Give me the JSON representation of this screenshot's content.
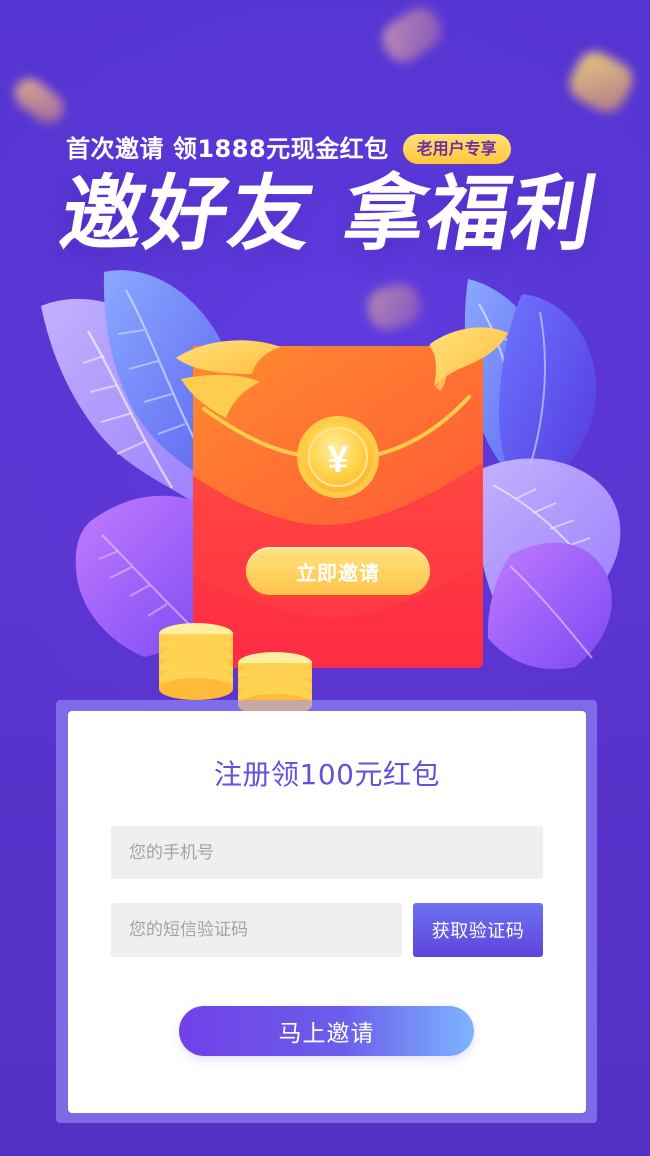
{
  "hero": {
    "subtitle": "首次邀请 领1888元现金红包",
    "badge": "老用户专享",
    "title": "邀好友 拿福利"
  },
  "envelope": {
    "currency_symbol": "¥",
    "button_label": "立即邀请"
  },
  "form": {
    "title": "注册领100元红包",
    "phone_placeholder": "您的手机号",
    "sms_placeholder": "您的短信验证码",
    "get_code_label": "获取验证码",
    "submit_label": "马上邀请"
  },
  "icons": {
    "currency": "yuan-coin-icon"
  },
  "colors": {
    "background": "#5a34cf",
    "form_title": "#6352df",
    "primary_button": "#6c5ce7",
    "accent_yellow": "#ffd45b",
    "envelope_red": "#ff3a45"
  }
}
